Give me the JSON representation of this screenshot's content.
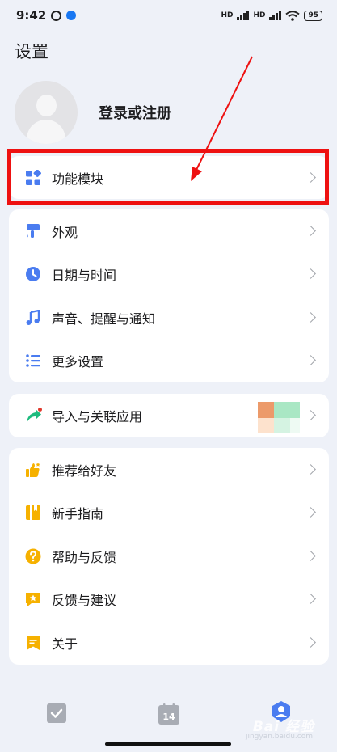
{
  "status_bar": {
    "time": "9:42",
    "battery": "95",
    "signal_tag": "HD"
  },
  "page": {
    "title": "设置"
  },
  "profile": {
    "login_label": "登录或注册"
  },
  "highlighted_item": {
    "label": "功能模块",
    "icon": "grid-icon",
    "color": "#4a7cf0"
  },
  "group_main": [
    {
      "label": "外观",
      "icon": "paint-roller-icon",
      "color": "#4a7cf0"
    },
    {
      "label": "日期与时间",
      "icon": "clock-icon",
      "color": "#4a7cf0"
    },
    {
      "label": "声音、提醒与通知",
      "icon": "music-note-icon",
      "color": "#4a7cf0"
    },
    {
      "label": "更多设置",
      "icon": "list-icon",
      "color": "#4a7cf0"
    }
  ],
  "group_import": {
    "label": "导入与关联应用",
    "icon": "share-arrow-icon",
    "color": "#1dbb7e",
    "badge_color": "#e0392c"
  },
  "group_help": [
    {
      "label": "推荐给好友",
      "icon": "thumbs-up-icon",
      "color": "#f6b100"
    },
    {
      "label": "新手指南",
      "icon": "book-icon",
      "color": "#f6b100"
    },
    {
      "label": "帮助与反馈",
      "icon": "help-icon",
      "color": "#f6b100"
    },
    {
      "label": "反馈与建议",
      "icon": "feedback-icon",
      "color": "#f6b100"
    },
    {
      "label": "关于",
      "icon": "flag-icon",
      "color": "#f6b100"
    }
  ],
  "bottom_nav": {
    "calendar_day": "14",
    "items": [
      "checklist-tab-icon",
      "calendar-tab-icon",
      "profile-tab-icon"
    ]
  },
  "watermark": {
    "text": "Bai 经验",
    "sub": "jingyan.baidu.com"
  },
  "colors": {
    "accent": "#4a7cf0",
    "highlight": "#ee1111",
    "background": "#eef1f8"
  }
}
